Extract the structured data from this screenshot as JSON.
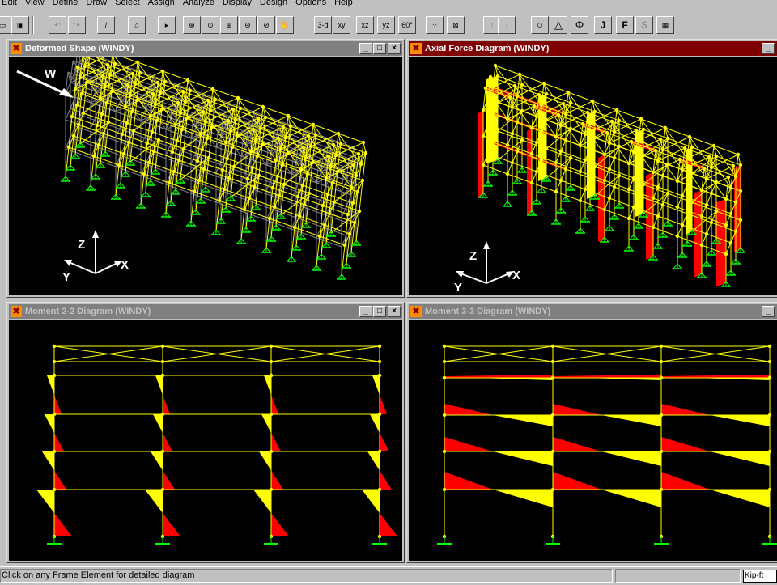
{
  "menu": [
    "Edit",
    "View",
    "Define",
    "Draw",
    "Select",
    "Assign",
    "Analyze",
    "Display",
    "Design",
    "Options",
    "Help"
  ],
  "toolbar": {
    "view_3d": "3-d",
    "view_xy": "xy",
    "view_xz": "xz",
    "view_yz": "yz",
    "view_rotate": "60°",
    "btn_j": "J",
    "btn_f": "F",
    "btn_s": "S"
  },
  "windows": {
    "deformed": {
      "title": "Deformed Shape (WINDY)",
      "annotation_w": "W",
      "axis_z": "Z",
      "axis_x": "X",
      "axis_y": "Y"
    },
    "axial": {
      "title": "Axial Force Diagram   (WINDY)",
      "axis_z": "Z",
      "axis_x": "X",
      "axis_y": "Y"
    },
    "m22": {
      "title": "Moment 2-2 Diagram   (WINDY)"
    },
    "m33": {
      "title": "Moment 3-3 Diagram   (WINDY)"
    }
  },
  "window_buttons": {
    "minimize": "_",
    "maximize": "□",
    "close": "×"
  },
  "status": {
    "text": "Click on any Frame Element for detailed diagram",
    "units": "Kip-ft"
  },
  "colors": {
    "frame": "#ffff00",
    "negative": "#ff0000",
    "positive": "#ffff00",
    "support": "#00ff00",
    "unloaded": "#808080",
    "active_title": "#800000"
  }
}
